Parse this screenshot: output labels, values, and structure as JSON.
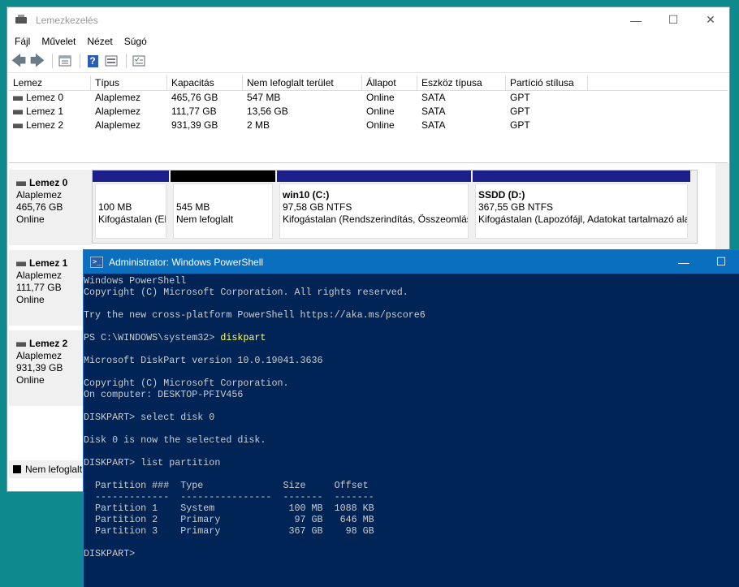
{
  "window": {
    "title": "Lemezkezelés",
    "controls": {
      "minimize": "—",
      "maximize": "☐",
      "close": "✕"
    }
  },
  "menu": [
    "Fájl",
    "Művelet",
    "Nézet",
    "Súgó"
  ],
  "toolbar": {
    "icons": [
      "back-arrow-icon",
      "forward-arrow-icon",
      "properties-icon",
      "help-icon",
      "view-icon",
      "checklist-icon"
    ],
    "back": "🡄",
    "forward": "🡆",
    "help": "?"
  },
  "volume_list": {
    "columns": [
      "Lemez",
      "Típus",
      "Kapacitás",
      "Nem lefoglalt terület",
      "Állapot",
      "Eszköz típusa",
      "Partíció stílusa"
    ],
    "rows": [
      [
        "Lemez 0",
        "Alaplemez",
        "465,76 GB",
        "547 MB",
        "Online",
        "SATA",
        "GPT"
      ],
      [
        "Lemez 1",
        "Alaplemez",
        "111,77 GB",
        "13,56 GB",
        "Online",
        "SATA",
        "GPT"
      ],
      [
        "Lemez 2",
        "Alaplemez",
        "931,39 GB",
        "2 MB",
        "Online",
        "SATA",
        "GPT"
      ]
    ]
  },
  "disks": [
    {
      "name": "Lemez 0",
      "type": "Alaplemez",
      "size": "465,76 GB",
      "status": "Online"
    },
    {
      "name": "Lemez 1",
      "type": "Alaplemez",
      "size": "111,77 GB",
      "status": "Online"
    },
    {
      "name": "Lemez 2",
      "type": "Alaplemez",
      "size": "931,39 GB",
      "status": "Online"
    }
  ],
  "disk0_volumes": [
    {
      "title": "",
      "size": "100 MB",
      "status": "Kifogástalan (EFI",
      "bar": "#1a1f8a"
    },
    {
      "title": "",
      "size": "545 MB",
      "status": "Nem lefoglalt",
      "bar": "#000000"
    },
    {
      "title": "win10  (C:)",
      "size": "97,58 GB NTFS",
      "status": "Kifogástalan (Rendszerindítás, Összeomlási",
      "bar": "#1a1f8a"
    },
    {
      "title": "SSDD  (D:)",
      "size": "367,55 GB NTFS",
      "status": "Kifogástalan (Lapozófájl, Adatokat tartalmazó ala",
      "bar": "#1a1f8a"
    }
  ],
  "legend": {
    "label": "Nem lefoglalt",
    "color": "#000000"
  },
  "powershell": {
    "title": "Administrator: Windows PowerShell",
    "controls": {
      "minimize": "—",
      "maximize": "☐"
    },
    "lines": [
      "Windows PowerShell",
      "Copyright (C) Microsoft Corporation. All rights reserved.",
      "",
      "Try the new cross-platform PowerShell https://aka.ms/pscore6",
      "",
      "PS C:\\WINDOWS\\system32> ",
      "",
      "Microsoft DiskPart version 10.0.19041.3636",
      "",
      "Copyright (C) Microsoft Corporation.",
      "On computer: DESKTOP-PFIV456",
      "",
      "DISKPART> select disk 0",
      "",
      "Disk 0 is now the selected disk.",
      "",
      "DISKPART> list partition",
      "",
      "  Partition ###  Type              Size     Offset",
      "  -------------  ----------------  -------  -------",
      "  Partition 1    System             100 MB  1088 KB",
      "  Partition 2    Primary             97 GB   646 MB",
      "  Partition 3    Primary            367 GB    98 GB",
      "",
      "DISKPART> "
    ],
    "typed_command": "diskpart",
    "text_color": "#cccccc",
    "highlight_color": "#ffff66",
    "background": "#012456"
  }
}
